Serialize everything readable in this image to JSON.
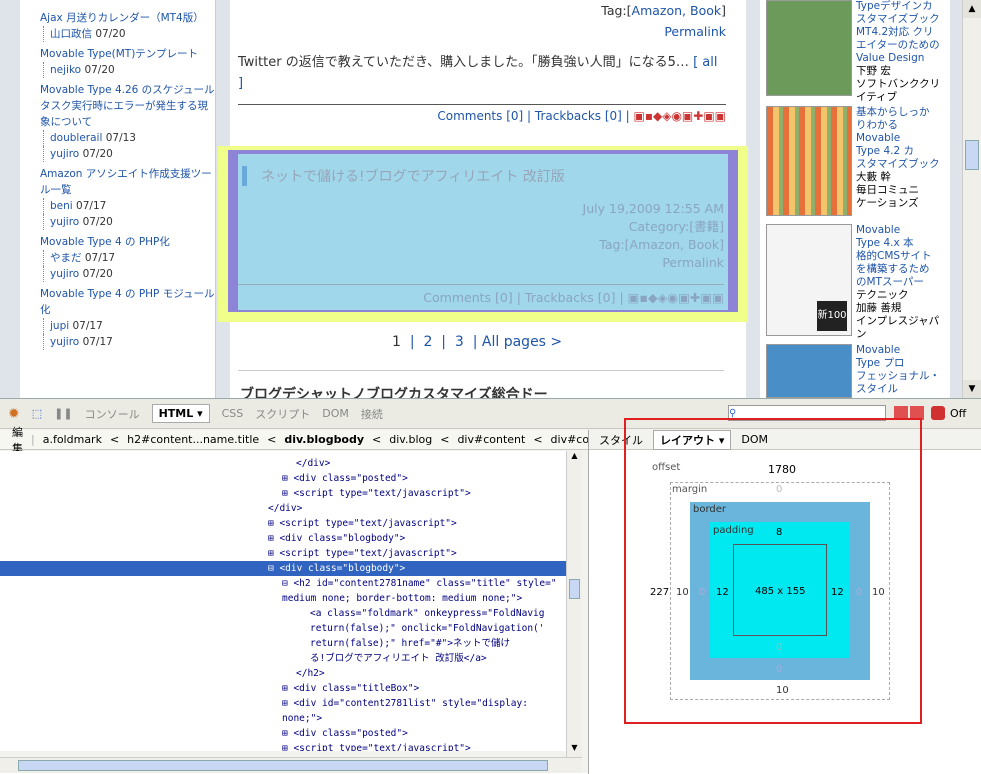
{
  "sidebar_left": [
    {
      "title": "Ajax 月送りカレンダー（MT4版）",
      "comments": [
        {
          "name": "山口政信",
          "date": "07/20"
        }
      ]
    },
    {
      "title": "Movable Type(MT)テンプレート",
      "comments": [
        {
          "name": "nejiko",
          "date": "07/20"
        }
      ]
    },
    {
      "title": "Movable Type 4.26 のスケジュールタスク実行時にエラーが発生する現象について",
      "comments": [
        {
          "name": "doublerail",
          "date": "07/13"
        },
        {
          "name": "yujiro",
          "date": "07/20"
        }
      ]
    },
    {
      "title": "Amazon アソシエイト作成支援ツール一覧",
      "comments": [
        {
          "name": "beni",
          "date": "07/17"
        },
        {
          "name": "yujiro",
          "date": "07/20"
        }
      ]
    },
    {
      "title": "Movable Type 4 の PHP化",
      "comments": [
        {
          "name": "やまだ",
          "date": "07/17"
        },
        {
          "name": "yujiro",
          "date": "07/20"
        }
      ]
    },
    {
      "title": "Movable Type 4 の PHP モジュール化",
      "comments": [
        {
          "name": "jupi",
          "date": "07/17"
        },
        {
          "name": "yujiro",
          "date": "07/17"
        }
      ]
    }
  ],
  "post1": {
    "tag_label": "Tag:",
    "tags": "Amazon, Book",
    "permalink": "Permalink",
    "excerpt": "Twitter の返信で教えていただき、購入しました。「勝負強い人間」になる5…",
    "more": "[ all ]",
    "comments": "Comments [0]",
    "trackbacks": "Trackbacks [0]"
  },
  "post2": {
    "title": "ネットで儲ける!ブログでアフィリエイト 改訂版",
    "date": "July 19,2009 12:55 AM",
    "category_label": "Category:",
    "category": "書籍",
    "tag_label": "Tag:",
    "tags": "Amazon, Book",
    "permalink": "Permalink",
    "comments": "Comments [0]",
    "trackbacks": "Trackbacks [0]"
  },
  "pagination": {
    "p1": "1",
    "p2": "2",
    "p3": "3",
    "all": "All pages >"
  },
  "next_heading": "ブログデシャットノブログカスタマイズ総合ドー",
  "books": [
    {
      "lines": [
        "Typeデザインカ",
        "スタマイズブック",
        "MT4.2対応 クリ",
        "エイターのための",
        "Value Design",
        "下野 宏",
        "ソフトバンククリ",
        "イティブ"
      ]
    },
    {
      "lines": [
        "基本からしっか",
        "りわかる",
        "Movable",
        "Type 4.2 カ",
        "スタマイズブック",
        "大藪 幹",
        "毎日コミュニ",
        "ケーションズ"
      ]
    },
    {
      "lines": [
        "Movable",
        "Type 4.x 本",
        "格的CMSサイト",
        "を構築するため",
        "のMTスーパー",
        "テクニック",
        "加藤 善規",
        "インプレスジャパ",
        "ン"
      ]
    },
    {
      "lines": [
        "Movable",
        "Type プロ",
        "フェッショナル・",
        "スタイル"
      ]
    }
  ],
  "firebug": {
    "toolbar": [
      "コンソール",
      "HTML ▾",
      "CSS",
      "スクリプト",
      "DOM",
      "接続"
    ],
    "off_label": "Off",
    "breadcrumb": [
      "編集",
      "a.foldmark",
      "h2#content...name.title",
      "div.blogbody",
      "div.blog",
      "div#content",
      "div#contentBox"
    ],
    "right_tabs": [
      "スタイル",
      "レイアウト ▾",
      "DOM"
    ],
    "code": [
      {
        "t": "</div>",
        "i": 2,
        "c": "tag"
      },
      {
        "t": "⊞ <div class=\"posted\">",
        "i": 1
      },
      {
        "t": "⊞ <script type=\"text/javascript\">",
        "i": 1
      },
      {
        "t": "</div>",
        "i": 0,
        "c": "tag"
      },
      {
        "t": "⊞ <script type=\"text/javascript\">",
        "i": 0
      },
      {
        "t": "⊞ <div class=\"blogbody\">",
        "i": 0
      },
      {
        "t": "⊞ <script type=\"text/javascript\">",
        "i": 0
      },
      {
        "t": "⊟ <div class=\"blogbody\">",
        "i": 0,
        "sel": true
      },
      {
        "t": "⊟ <h2 id=\"content2781name\" class=\"title\" style=\"",
        "i": 1
      },
      {
        "t": "medium none; border-bottom: medium none;\">",
        "i": 1
      },
      {
        "t": "<a class=\"foldmark\" onkeypress=\"FoldNavig",
        "i": 3
      },
      {
        "t": "return(false);\" onclick=\"FoldNavigation('",
        "i": 3
      },
      {
        "t": "return(false);\" href=\"#\">ネットで儲け",
        "i": 3
      },
      {
        "t": "る!ブログでアフィリエイト 改訂版</a>",
        "i": 3
      },
      {
        "t": "</h2>",
        "i": 2,
        "c": "tag"
      },
      {
        "t": "⊞ <div class=\"titleBox\">",
        "i": 1
      },
      {
        "t": "⊞ <div id=\"content2781list\" style=\"display:",
        "i": 1
      },
      {
        "t": "none;\">",
        "i": 1
      },
      {
        "t": "⊞ <div class=\"posted\">",
        "i": 1
      },
      {
        "t": "⊞ <script type=\"text/javascript\">",
        "i": 1
      }
    ],
    "layout": {
      "offset_label": "offset",
      "offset_top": "1780",
      "offset_left": "227",
      "margin_label": "margin",
      "margin_top": "0",
      "margin_left": "0",
      "margin_right": "0",
      "margin_bottom": "0",
      "border_label": "border",
      "border_left": "10",
      "border_right": "10",
      "border_bottom": "10",
      "padding_label": "padding",
      "padding_top": "8",
      "padding_left": "12",
      "padding_right": "12",
      "padding_bottom": "0",
      "content_size": "485 x 155"
    }
  }
}
